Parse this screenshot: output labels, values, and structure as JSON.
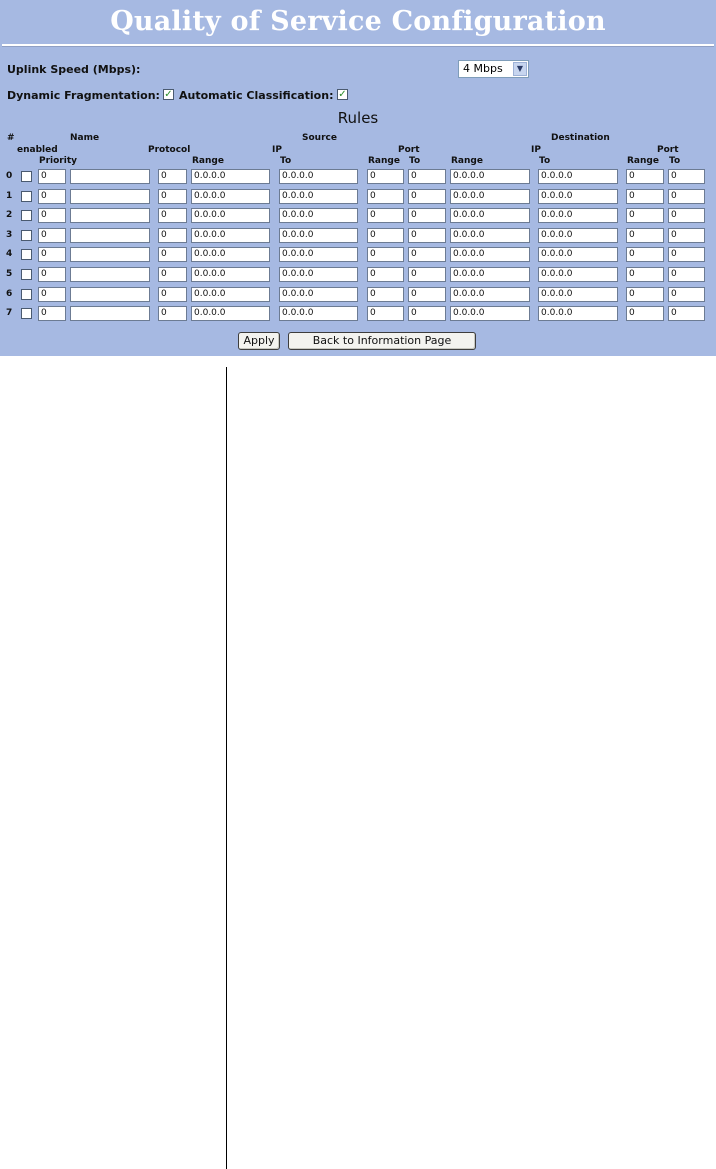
{
  "title": "Quality of Service Configuration",
  "uplink": {
    "label": "Uplink Speed (Mbps):",
    "value": "4 Mbps"
  },
  "dynamic_fragmentation": {
    "label": "Dynamic Fragmentation:",
    "checked": true
  },
  "automatic_classification": {
    "label": "Automatic Classification:",
    "checked": true
  },
  "rules_title": "Rules",
  "headers": {
    "num": "#",
    "name": "Name",
    "source": "Source",
    "destination": "Destination",
    "enabled": "enabled",
    "protocol": "Protocol",
    "src_ip": "IP",
    "src_port": "Port",
    "dst_ip": "IP",
    "dst_port": "Port",
    "priority": "Priority",
    "src_ip_range": "Range",
    "src_ip_to": "To",
    "src_port_range": "Range",
    "src_port_to": "To",
    "dst_ip_range": "Range",
    "dst_ip_to": "To",
    "dst_port_range": "Range",
    "dst_port_to": "To"
  },
  "rows": [
    {
      "num": "0",
      "enabled": false,
      "priority": "0",
      "name": "",
      "protocol": "0",
      "src_ip_range": "0.0.0.0",
      "src_ip_to": "0.0.0.0",
      "src_port_range": "0",
      "src_port_to": "0",
      "dst_ip_range": "0.0.0.0",
      "dst_ip_to": "0.0.0.0",
      "dst_port_range": "0",
      "dst_port_to": "0"
    },
    {
      "num": "1",
      "enabled": false,
      "priority": "0",
      "name": "",
      "protocol": "0",
      "src_ip_range": "0.0.0.0",
      "src_ip_to": "0.0.0.0",
      "src_port_range": "0",
      "src_port_to": "0",
      "dst_ip_range": "0.0.0.0",
      "dst_ip_to": "0.0.0.0",
      "dst_port_range": "0",
      "dst_port_to": "0"
    },
    {
      "num": "2",
      "enabled": false,
      "priority": "0",
      "name": "",
      "protocol": "0",
      "src_ip_range": "0.0.0.0",
      "src_ip_to": "0.0.0.0",
      "src_port_range": "0",
      "src_port_to": "0",
      "dst_ip_range": "0.0.0.0",
      "dst_ip_to": "0.0.0.0",
      "dst_port_range": "0",
      "dst_port_to": "0"
    },
    {
      "num": "3",
      "enabled": false,
      "priority": "0",
      "name": "",
      "protocol": "0",
      "src_ip_range": "0.0.0.0",
      "src_ip_to": "0.0.0.0",
      "src_port_range": "0",
      "src_port_to": "0",
      "dst_ip_range": "0.0.0.0",
      "dst_ip_to": "0.0.0.0",
      "dst_port_range": "0",
      "dst_port_to": "0"
    },
    {
      "num": "4",
      "enabled": false,
      "priority": "0",
      "name": "",
      "protocol": "0",
      "src_ip_range": "0.0.0.0",
      "src_ip_to": "0.0.0.0",
      "src_port_range": "0",
      "src_port_to": "0",
      "dst_ip_range": "0.0.0.0",
      "dst_ip_to": "0.0.0.0",
      "dst_port_range": "0",
      "dst_port_to": "0"
    },
    {
      "num": "5",
      "enabled": false,
      "priority": "0",
      "name": "",
      "protocol": "0",
      "src_ip_range": "0.0.0.0",
      "src_ip_to": "0.0.0.0",
      "src_port_range": "0",
      "src_port_to": "0",
      "dst_ip_range": "0.0.0.0",
      "dst_ip_to": "0.0.0.0",
      "dst_port_range": "0",
      "dst_port_to": "0"
    },
    {
      "num": "6",
      "enabled": false,
      "priority": "0",
      "name": "",
      "protocol": "0",
      "src_ip_range": "0.0.0.0",
      "src_ip_to": "0.0.0.0",
      "src_port_range": "0",
      "src_port_to": "0",
      "dst_ip_range": "0.0.0.0",
      "dst_ip_to": "0.0.0.0",
      "dst_port_range": "0",
      "dst_port_to": "0"
    },
    {
      "num": "7",
      "enabled": false,
      "priority": "0",
      "name": "",
      "protocol": "0",
      "src_ip_range": "0.0.0.0",
      "src_ip_to": "0.0.0.0",
      "src_port_range": "0",
      "src_port_to": "0",
      "dst_ip_range": "0.0.0.0",
      "dst_ip_to": "0.0.0.0",
      "dst_port_range": "0",
      "dst_port_to": "0"
    }
  ],
  "buttons": {
    "apply": "Apply",
    "back": "Back to Information Page"
  },
  "colors": {
    "panel_bg": "#a6b9e2",
    "title": "#ffffff",
    "check": "#2a8c2a"
  }
}
